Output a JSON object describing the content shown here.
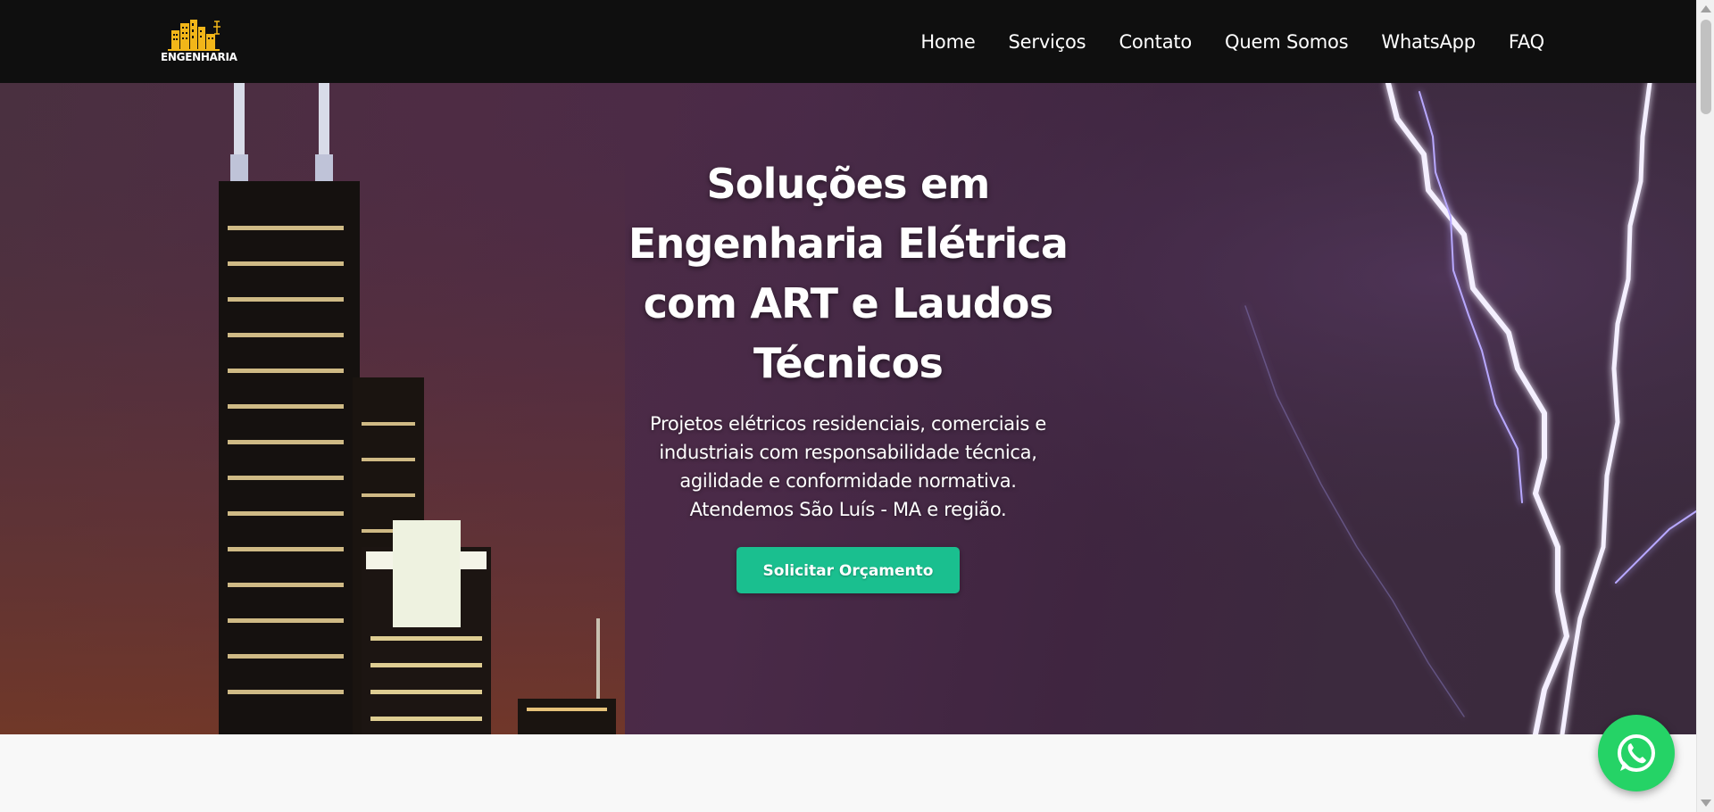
{
  "navbar": {
    "logo_text": "ENGENHARIA",
    "links": [
      {
        "label": "Home"
      },
      {
        "label": "Serviços"
      },
      {
        "label": "Contato"
      },
      {
        "label": "Quem Somos"
      },
      {
        "label": "WhatsApp"
      },
      {
        "label": "FAQ"
      }
    ]
  },
  "hero": {
    "title": "Soluções em Engenharia Elétrica com ART e Laudos Técnicos",
    "subtitle": "Projetos elétricos residenciais, comerciais e industriais com responsabilidade técnica, agilidade e conformidade normativa. Atendemos São Luís - MA e região.",
    "cta_label": "Solicitar Orçamento"
  },
  "icons": {
    "logo": "building-logo-icon",
    "whatsapp": "whatsapp-icon"
  },
  "colors": {
    "navbar_bg": "#0f0f0f",
    "cta_bg": "#1abf8f",
    "whatsapp_green": "#25d366",
    "logo_gold": "#f2b619"
  }
}
